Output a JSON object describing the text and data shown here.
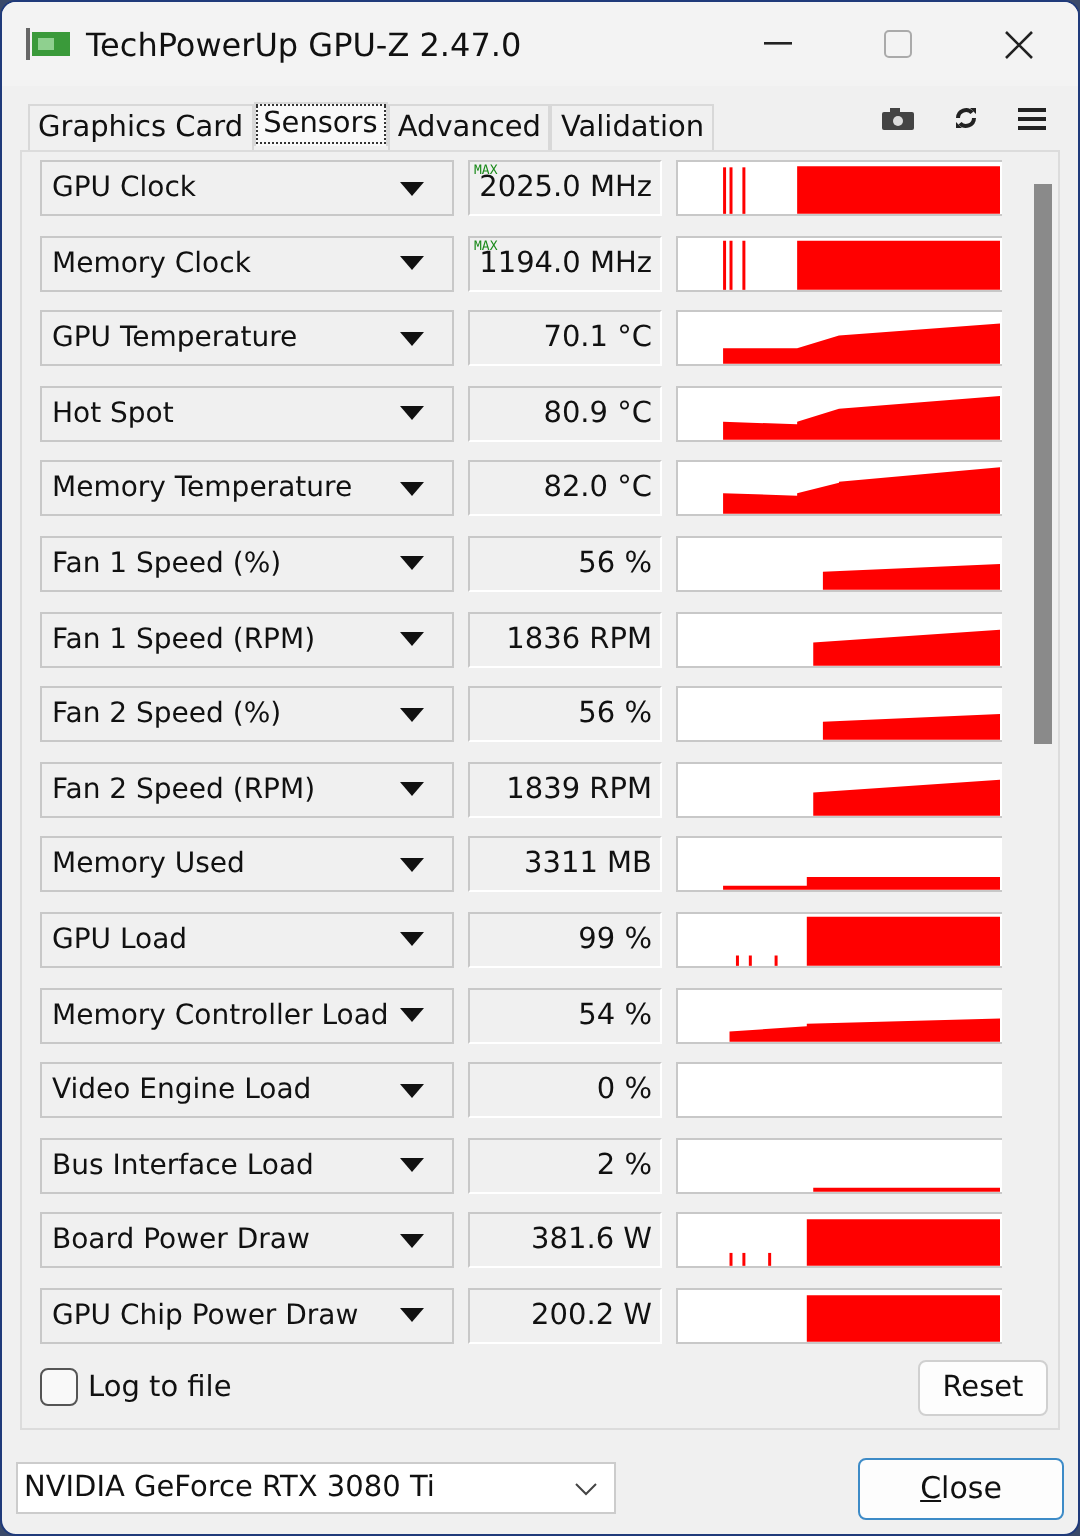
{
  "window": {
    "title": "TechPowerUp GPU-Z 2.47.0"
  },
  "tabs": [
    {
      "label": "Graphics Card",
      "selected": false
    },
    {
      "label": "Sensors",
      "selected": true
    },
    {
      "label": "Advanced",
      "selected": false
    },
    {
      "label": "Validation",
      "selected": false
    }
  ],
  "sensors": [
    {
      "name": "GPU Clock",
      "badge": "MAX",
      "value": "2025.0 MHz"
    },
    {
      "name": "Memory Clock",
      "badge": "MAX",
      "value": "1194.0 MHz"
    },
    {
      "name": "GPU Temperature",
      "value": "70.1 °C"
    },
    {
      "name": "Hot Spot",
      "value": "80.9 °C"
    },
    {
      "name": "Memory Temperature",
      "value": "82.0 °C"
    },
    {
      "name": "Fan 1 Speed (%)",
      "value": "56 %"
    },
    {
      "name": "Fan 1 Speed (RPM)",
      "value": "1836 RPM"
    },
    {
      "name": "Fan 2 Speed (%)",
      "value": "56 %"
    },
    {
      "name": "Fan 2 Speed (RPM)",
      "value": "1839 RPM"
    },
    {
      "name": "Memory Used",
      "value": "3311 MB"
    },
    {
      "name": "GPU Load",
      "value": "99 %"
    },
    {
      "name": "Memory Controller Load",
      "value": "54 %"
    },
    {
      "name": "Video Engine Load",
      "value": "0 %"
    },
    {
      "name": "Bus Interface Load",
      "value": "2 %"
    },
    {
      "name": "Board Power Draw",
      "value": "381.6 W"
    },
    {
      "name": "GPU Chip Power Draw",
      "value": "200.2 W"
    }
  ],
  "log_to_file": {
    "label": "Log to file",
    "checked": false
  },
  "reset_button": "Reset",
  "device_select": {
    "value": "NVIDIA GeForce RTX 3080 Ti"
  },
  "close_button": "Close"
}
